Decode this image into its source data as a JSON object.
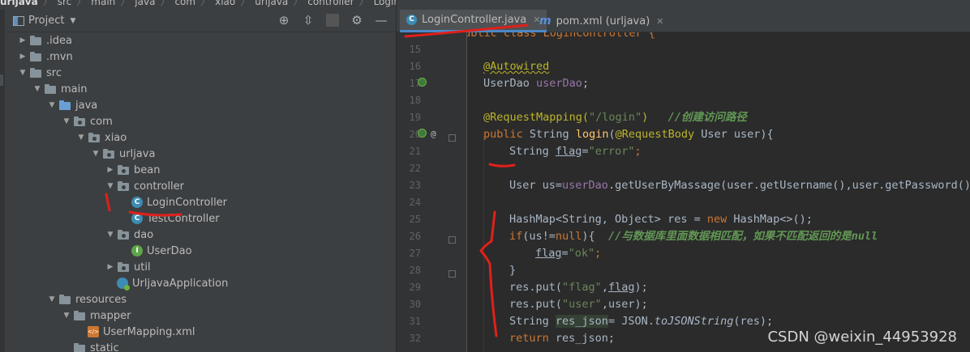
{
  "breadcrumb": [
    "urljava",
    "src",
    "main",
    "java",
    "com",
    "xiao",
    "urljava",
    "controller",
    "LoginController"
  ],
  "project_panel": {
    "title": "Project",
    "tree": [
      {
        "label": ".idea",
        "depth": 1,
        "expanded": false,
        "icon": "folder"
      },
      {
        "label": ".mvn",
        "depth": 1,
        "expanded": false,
        "icon": "folder"
      },
      {
        "label": "src",
        "depth": 1,
        "expanded": true,
        "icon": "folder"
      },
      {
        "label": "main",
        "depth": 2,
        "expanded": true,
        "icon": "folder"
      },
      {
        "label": "java",
        "depth": 3,
        "expanded": true,
        "icon": "folder-blue"
      },
      {
        "label": "com",
        "depth": 4,
        "expanded": true,
        "icon": "package"
      },
      {
        "label": "xiao",
        "depth": 5,
        "expanded": true,
        "icon": "package"
      },
      {
        "label": "urljava",
        "depth": 6,
        "expanded": true,
        "icon": "package"
      },
      {
        "label": "bean",
        "depth": 7,
        "expanded": false,
        "icon": "package"
      },
      {
        "label": "controller",
        "depth": 7,
        "expanded": true,
        "icon": "package"
      },
      {
        "label": "LoginController",
        "depth": 8,
        "expanded": null,
        "icon": "class"
      },
      {
        "label": "TestController",
        "depth": 8,
        "expanded": null,
        "icon": "class"
      },
      {
        "label": "dao",
        "depth": 7,
        "expanded": true,
        "icon": "package"
      },
      {
        "label": "UserDao",
        "depth": 8,
        "expanded": null,
        "icon": "interface"
      },
      {
        "label": "util",
        "depth": 7,
        "expanded": false,
        "icon": "package"
      },
      {
        "label": "UrljavaApplication",
        "depth": 7,
        "expanded": null,
        "icon": "spring-app"
      },
      {
        "label": "resources",
        "depth": 3,
        "expanded": true,
        "icon": "folder"
      },
      {
        "label": "mapper",
        "depth": 4,
        "expanded": true,
        "icon": "folder"
      },
      {
        "label": "UserMapping.xml",
        "depth": 5,
        "expanded": null,
        "icon": "xml"
      },
      {
        "label": "static",
        "depth": 4,
        "expanded": null,
        "icon": "folder"
      }
    ]
  },
  "tabs": [
    {
      "label": "LoginController.java",
      "active": true,
      "icon": "class"
    },
    {
      "label": "pom.xml (urljava)",
      "active": false,
      "icon": "maven"
    }
  ],
  "editor": {
    "line_numbers": [
      "15",
      "16",
      "17",
      "18",
      "19",
      "20",
      "21",
      "22",
      "23",
      "24",
      "25",
      "26",
      "27",
      "28",
      "29",
      "30",
      "31",
      "32"
    ],
    "top_partial": "public class LoginController {"
  },
  "code": {
    "l16_ann": "@Autowired",
    "l17_type": "UserDao ",
    "l17_field": "userDao",
    "l17_end": ";",
    "l19_ann": "@RequestMapping(",
    "l19_str": "\"/login\"",
    "l19_close": ")",
    "l19_cmt": "//创建访问路径",
    "l20_kw": "public ",
    "l20_type": "String ",
    "l20_method": "login",
    "l20_paren": "(",
    "l20_ann": "@RequestBody",
    "l20_rest": " User user){",
    "l21_type": "String ",
    "l21_var": "flag",
    "l21_eq": "=",
    "l21_str": "\"error\"",
    "l21_end": ";",
    "l23_a": "User us=",
    "l23_field": "userDao",
    "l23_b": ".getUserByMassage(user.getUsername(),user.getPassword());",
    "l25_a": "HashMap<String, Object> res = ",
    "l25_kw": "new",
    "l25_b": " HashMap<>();",
    "l26_kw": "if",
    "l26_a": "(us!=",
    "l26_kw2": "null",
    "l26_b": "){  ",
    "l26_cmt": "//与数据库里面数据相匹配，如果不匹配返回的是",
    "l26_cmt_null": "null",
    "l27_var": "flag",
    "l27_eq": "=",
    "l27_str": "\"ok\"",
    "l27_end": ";",
    "l28": "}",
    "l29_a": "res.put(",
    "l29_str": "\"flag\"",
    "l29_comma": ",",
    "l29_var": "flag",
    "l29_end": ");",
    "l30_a": "res.put(",
    "l30_str": "\"user\"",
    "l30_b": ",user);",
    "l31_type": "String ",
    "l31_var": "res_json",
    "l31_a": "= JSON.",
    "l31_method": "toJSONString",
    "l31_b": "(res);",
    "l32_kw": "return",
    "l32_a": " res_json;"
  },
  "watermark": "CSDN @weixin_44953928",
  "annotation_color": "#e0201a"
}
